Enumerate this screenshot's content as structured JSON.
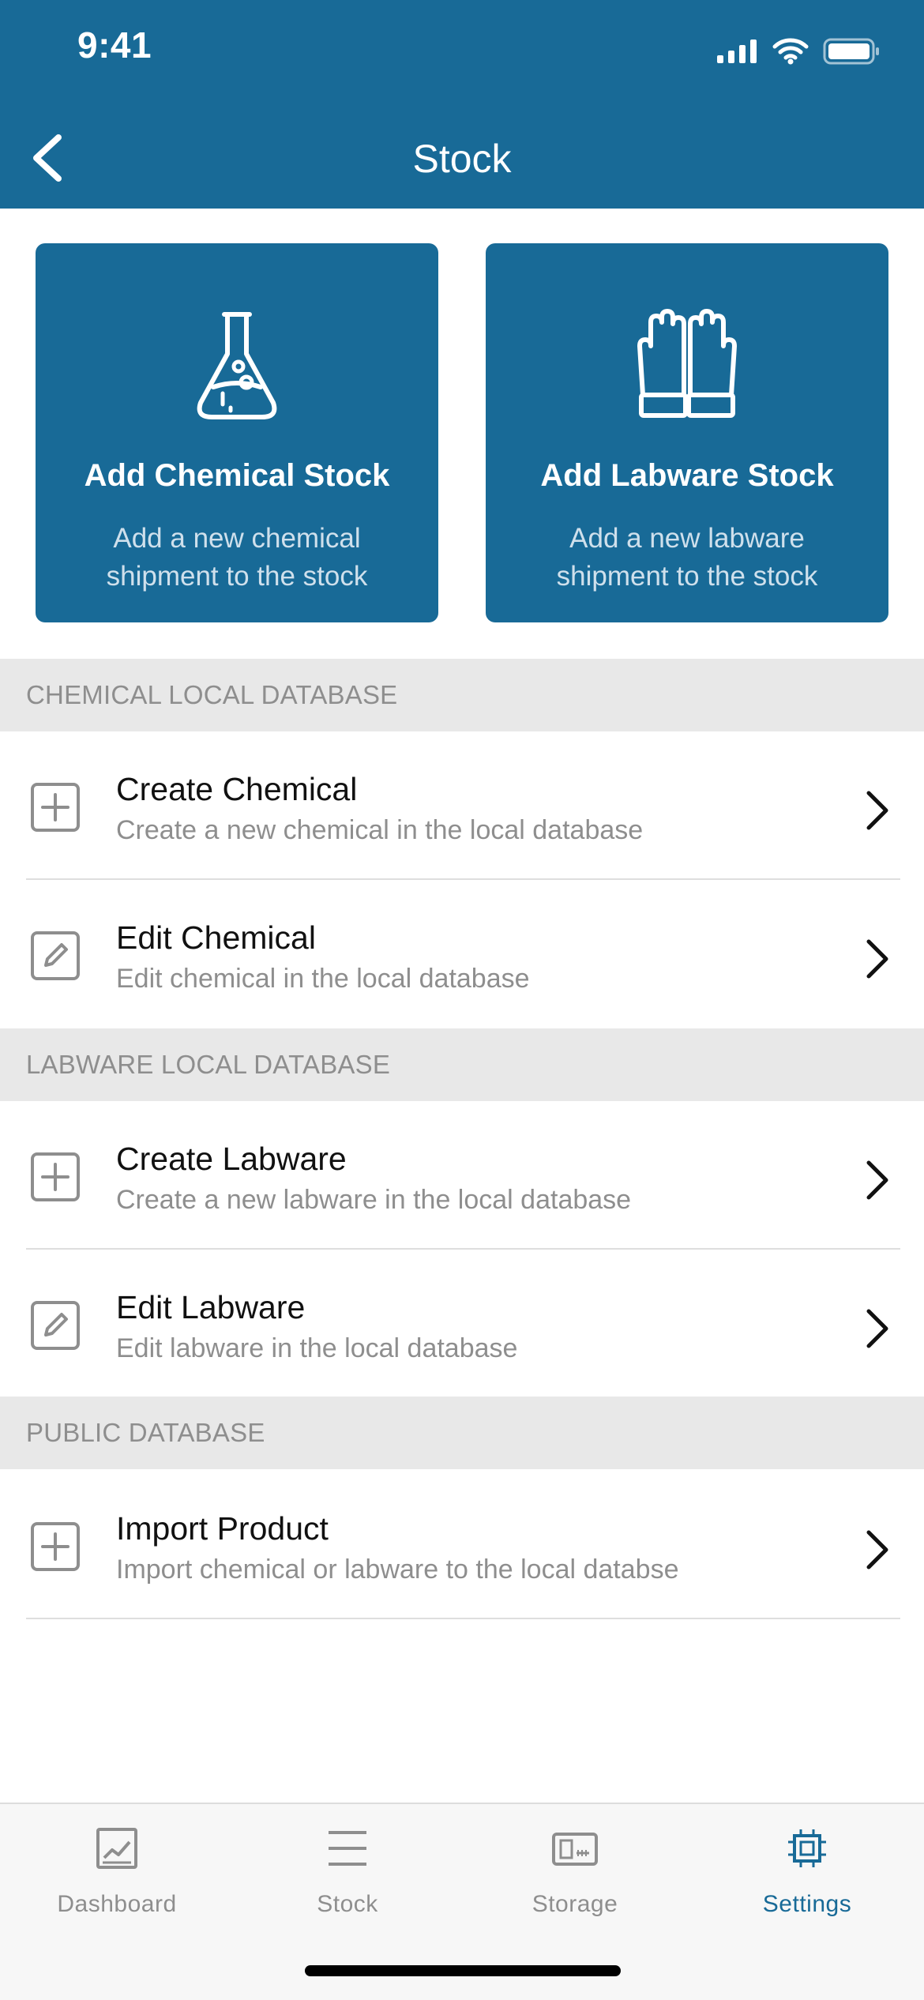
{
  "status_bar": {
    "time": "9:41"
  },
  "nav": {
    "title": "Stock"
  },
  "cards": [
    {
      "title": "Add Chemical Stock",
      "subtitle": "Add a new chemical shipment to the stock",
      "icon": "flask-icon"
    },
    {
      "title": "Add Labware Stock",
      "subtitle": "Add a new labware shipment to the stock",
      "icon": "gloves-icon"
    }
  ],
  "sections": [
    {
      "header": "CHEMICAL LOCAL DATABASE",
      "items": [
        {
          "title": "Create Chemical",
          "subtitle": "Create a new chemical in the local database",
          "icon": "plus-square-icon"
        },
        {
          "title": "Edit Chemical",
          "subtitle": "Edit chemical in the local database",
          "icon": "edit-square-icon"
        }
      ]
    },
    {
      "header": "LABWARE LOCAL DATABASE",
      "items": [
        {
          "title": "Create Labware",
          "subtitle": "Create a new labware in the local database",
          "icon": "plus-square-icon"
        },
        {
          "title": "Edit Labware",
          "subtitle": "Edit labware in the local database",
          "icon": "edit-square-icon"
        }
      ]
    },
    {
      "header": "PUBLIC DATABASE",
      "items": [
        {
          "title": "Import Product",
          "subtitle": "Import chemical or labware to the local databse",
          "icon": "plus-square-icon"
        }
      ]
    }
  ],
  "tabs": [
    {
      "label": "Dashboard",
      "icon": "dashboard-icon",
      "active": false
    },
    {
      "label": "Stock",
      "icon": "stock-icon",
      "active": false
    },
    {
      "label": "Storage",
      "icon": "storage-icon",
      "active": false
    },
    {
      "label": "Settings",
      "icon": "settings-icon",
      "active": true
    }
  ],
  "colors": {
    "primary": "#186a97",
    "section_bg": "#e8e8e8",
    "muted_text": "#8e8e8e",
    "tabbar_bg": "#f7f7f7"
  }
}
